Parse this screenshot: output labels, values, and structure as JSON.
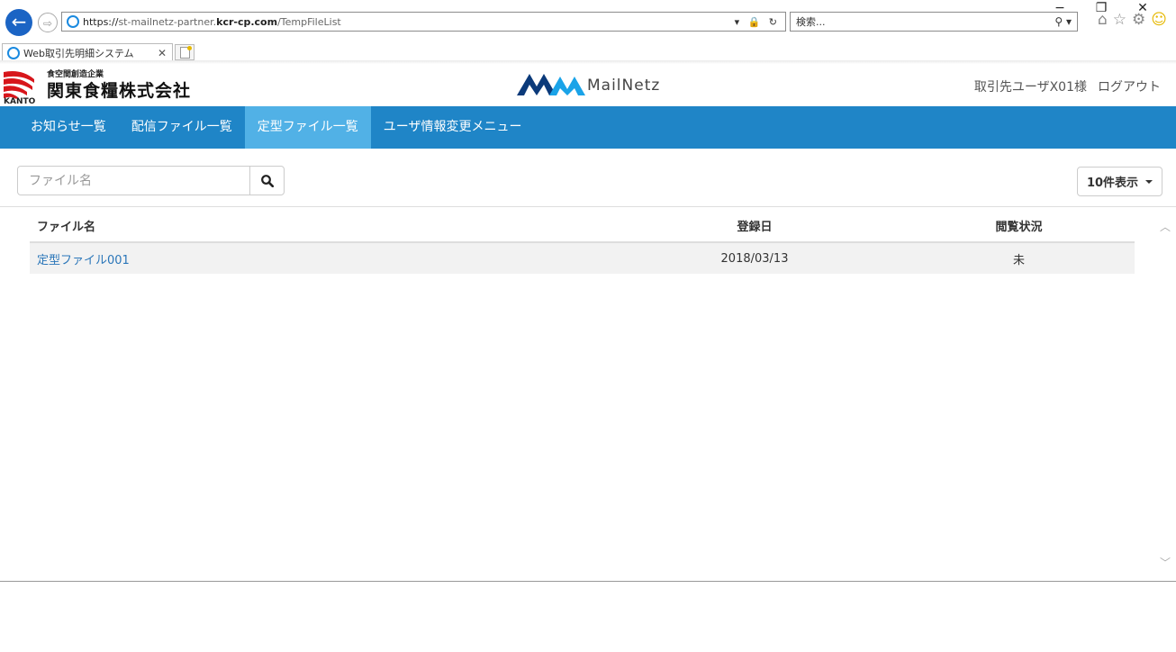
{
  "browser": {
    "url_scheme": "https://",
    "url_sub": "st-mailnetz-partner.",
    "url_domain": "kcr-cp.com",
    "url_path": "/TempFileList",
    "search_placeholder": "検索...",
    "tab_title": "Web取引先明細システム",
    "window_controls": {
      "minimize": "−",
      "restore": "❐",
      "close": "✕"
    }
  },
  "header": {
    "logo_sub": "食空間創造企業",
    "logo_name": "関東食糧株式会社",
    "logo_mark_text": "KANTO",
    "app_logo_text": "MailNetz",
    "user_name": "取引先ユーザX01様",
    "logout_label": "ログアウト"
  },
  "nav": {
    "items": [
      {
        "label": "お知らせ一覧"
      },
      {
        "label": "配信ファイル一覧"
      },
      {
        "label": "定型ファイル一覧",
        "active": true
      },
      {
        "label": "ユーザ情報変更メニュー"
      }
    ]
  },
  "search": {
    "placeholder": "ファイル名",
    "value": ""
  },
  "page_size": {
    "label": "10件表示"
  },
  "table": {
    "headers": {
      "name": "ファイル名",
      "date": "登録日",
      "status": "閲覧状況"
    },
    "rows": [
      {
        "name": "定型ファイル001",
        "date": "2018/03/13",
        "status": "未"
      }
    ]
  },
  "colors": {
    "nav_bg": "#1f85c7",
    "nav_active": "#51b1e6",
    "link": "#2a76b9",
    "brand_red": "#d7161b"
  }
}
